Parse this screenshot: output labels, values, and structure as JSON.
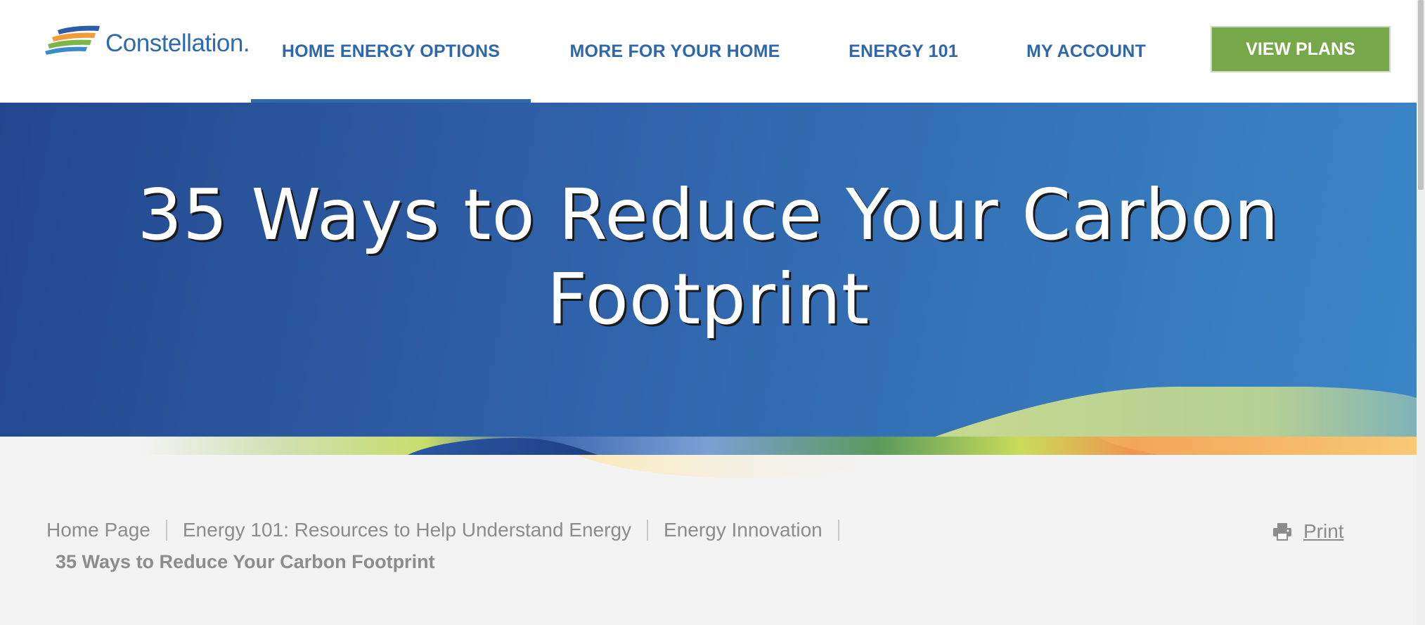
{
  "brand": {
    "name": "Constellation.",
    "logo_colors": [
      "#2b5ea7",
      "#f29b38",
      "#7ab648",
      "#3a8ad0"
    ]
  },
  "nav": {
    "items": [
      {
        "label": "HOME ENERGY OPTIONS",
        "active": true
      },
      {
        "label": "MORE FOR YOUR HOME",
        "active": false
      },
      {
        "label": "ENERGY 101",
        "active": false
      },
      {
        "label": "MY ACCOUNT",
        "active": false
      }
    ],
    "cta_label": "VIEW PLANS"
  },
  "hero": {
    "title_line1": "35 Ways to Reduce Your Carbon",
    "title_line2": "Footprint"
  },
  "breadcrumb": {
    "items": [
      {
        "label": "Home Page"
      },
      {
        "label": "Energy 101: Resources to Help Understand Energy"
      },
      {
        "label": "Energy Innovation"
      }
    ],
    "current": "35 Ways to Reduce Your Carbon Footprint"
  },
  "print": {
    "label": "Print",
    "icon": "printer-icon"
  },
  "colors": {
    "nav_text": "#2e67ac",
    "cta_bg": "#76a84a",
    "hero_start": "#23478e",
    "hero_end": "#3b86c8",
    "muted_text": "#8c8c8c"
  }
}
